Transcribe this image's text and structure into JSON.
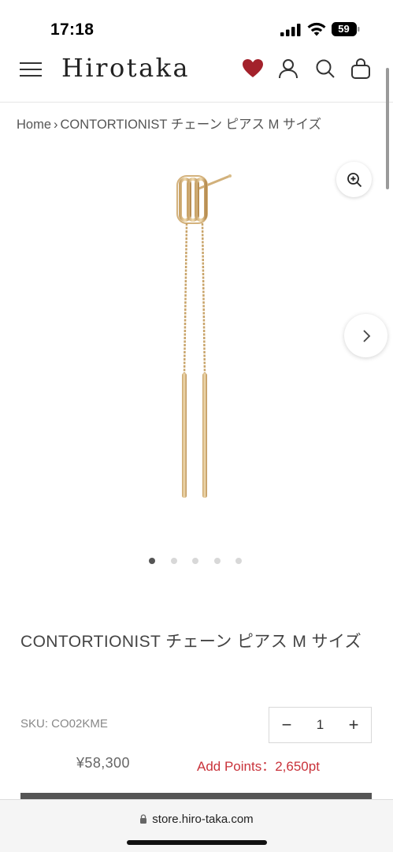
{
  "status_bar": {
    "time": "17:18",
    "battery": "59",
    "icons": [
      "signal-icon",
      "wifi-icon",
      "battery-icon"
    ]
  },
  "header": {
    "logo": "Hirotaka",
    "icons": [
      "menu-icon",
      "heart-icon",
      "account-icon",
      "search-icon",
      "cart-icon"
    ],
    "heart_color": "#a3212b"
  },
  "breadcrumb": {
    "home": "Home",
    "separator": "›",
    "current": "CONTORTIONIST チェーン ピアス M サイズ"
  },
  "gallery": {
    "image": "gold-chain-earring",
    "zoom_icon": "zoom-in-icon",
    "next_icon": "chevron-right-icon",
    "dots_total": 5,
    "dots_active_index": 0
  },
  "product": {
    "title": "CONTORTIONIST チェーン ピアス M サイズ",
    "sku": "SKU: CO02KME",
    "quantity": "1",
    "qty_minus": "−",
    "qty_plus": "+",
    "price": "¥58,300",
    "points": "Add Points：2,650pt",
    "points_color": "#c9333b"
  },
  "browser": {
    "url": "store.hiro-taka.com"
  }
}
